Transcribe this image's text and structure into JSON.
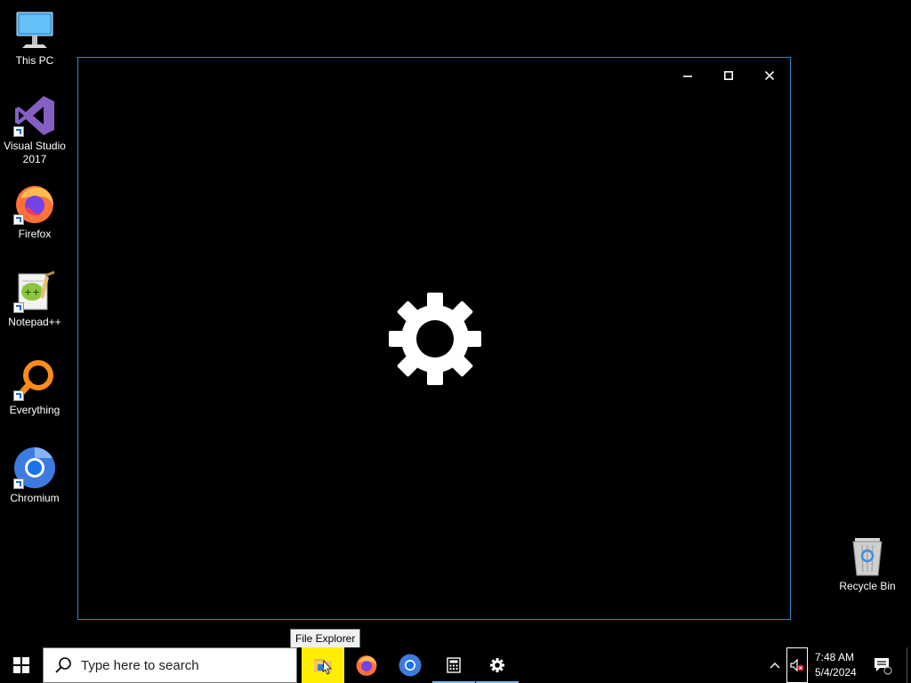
{
  "desktop": {
    "icons": [
      {
        "label": "This PC",
        "icon": "computer-icon"
      },
      {
        "label": "Visual Studio 2017",
        "icon": "visual-studio-icon"
      },
      {
        "label": "Firefox",
        "icon": "firefox-icon"
      },
      {
        "label": "Notepad++",
        "icon": "notepad-plus-plus-icon"
      },
      {
        "label": "Everything",
        "icon": "everything-search-icon"
      },
      {
        "label": "Chromium",
        "icon": "chromium-icon"
      },
      {
        "label": "Recycle Bin",
        "icon": "recycle-bin-icon"
      }
    ]
  },
  "settings_window": {
    "splash_icon": "gear-icon",
    "border_color": "#2f86c8"
  },
  "tooltip": {
    "text": "File Explorer"
  },
  "taskbar": {
    "search_placeholder": "Type here to search",
    "apps": [
      {
        "name": "File Explorer",
        "icon": "folder-icon",
        "highlighted": true
      },
      {
        "name": "Firefox",
        "icon": "firefox-icon"
      },
      {
        "name": "Chromium",
        "icon": "chromium-icon"
      },
      {
        "name": "Calculator",
        "icon": "calculator-icon",
        "running": true
      },
      {
        "name": "Settings",
        "icon": "gear-icon",
        "running": true
      }
    ],
    "highlight_color": "#ffee00",
    "running_indicator_color": "#76b9ed",
    "clock_time": "7:48 AM",
    "clock_date": "5/4/2024"
  }
}
